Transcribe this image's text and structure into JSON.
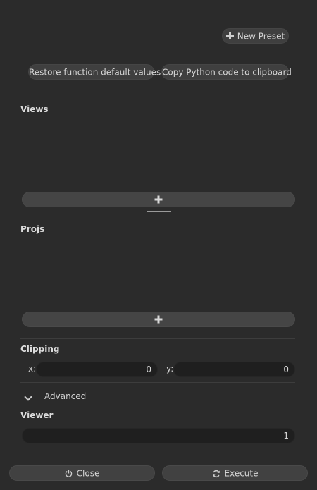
{
  "toolbar": {
    "new_preset_label": "New Preset",
    "restore_defaults_label": "Restore function default values",
    "copy_python_label": "Copy Python code to clipboard"
  },
  "sections": {
    "views_label": "Views",
    "projs_label": "Projs",
    "clipping_label": "Clipping",
    "viewer_label": "Viewer"
  },
  "clipping": {
    "x_label": "x:",
    "x_value": "0",
    "y_label": "y:",
    "y_value": "0"
  },
  "advanced": {
    "label": "Advanced",
    "expanded": false
  },
  "viewer": {
    "value": "-1"
  },
  "footer": {
    "close_label": "Close",
    "execute_label": "Execute"
  },
  "icons": {
    "new_preset": "plus-icon",
    "add_view": "plus-icon",
    "add_proj": "plus-icon",
    "advanced_toggle": "chevron-down-icon",
    "close": "power-icon",
    "execute": "refresh-icon"
  },
  "colors": {
    "background": "#2b2b2b",
    "button": "#3f3f3f",
    "field": "#1f1f1f",
    "text": "#d4d4d4"
  }
}
